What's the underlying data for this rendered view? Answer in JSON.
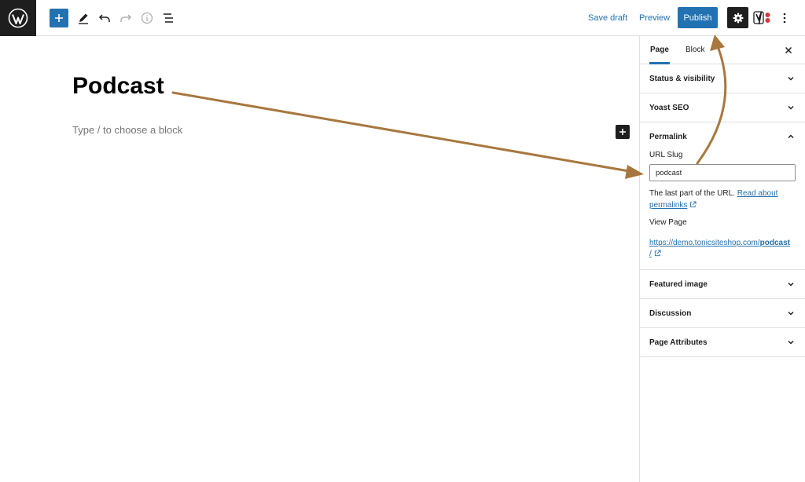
{
  "toolbar": {
    "save_draft": "Save draft",
    "preview": "Preview",
    "publish": "Publish"
  },
  "editor": {
    "title": "Podcast",
    "placeholder": "Type / to choose a block"
  },
  "sidebar": {
    "tabs": [
      "Page",
      "Block"
    ],
    "panels": {
      "status": "Status & visibility",
      "yoast": "Yoast SEO",
      "permalink": "Permalink",
      "featured": "Featured image",
      "discussion": "Discussion",
      "attributes": "Page Attributes"
    },
    "permalink": {
      "url_slug_label": "URL Slug",
      "slug_value": "podcast",
      "help_prefix": "The last part of the URL.",
      "help_link": "Read about permalinks",
      "view_page_label": "View Page",
      "link_base": "https://demo.tonicsiteshop.com/",
      "link_slug": "podcast",
      "link_tail": "/"
    }
  },
  "colors": {
    "accent": "#2271b1",
    "dark": "#1e1e1e",
    "annotation_arrow": "#a8773f",
    "yoast_red": "#d63638"
  },
  "icons": [
    "wordpress-logo-icon",
    "plus-icon",
    "pencil-icon",
    "undo-icon",
    "redo-icon",
    "info-icon",
    "list-view-icon",
    "gear-icon",
    "yoast-icon",
    "kebab-icon",
    "close-icon",
    "chevron-down-icon",
    "chevron-up-icon",
    "external-link-icon"
  ]
}
